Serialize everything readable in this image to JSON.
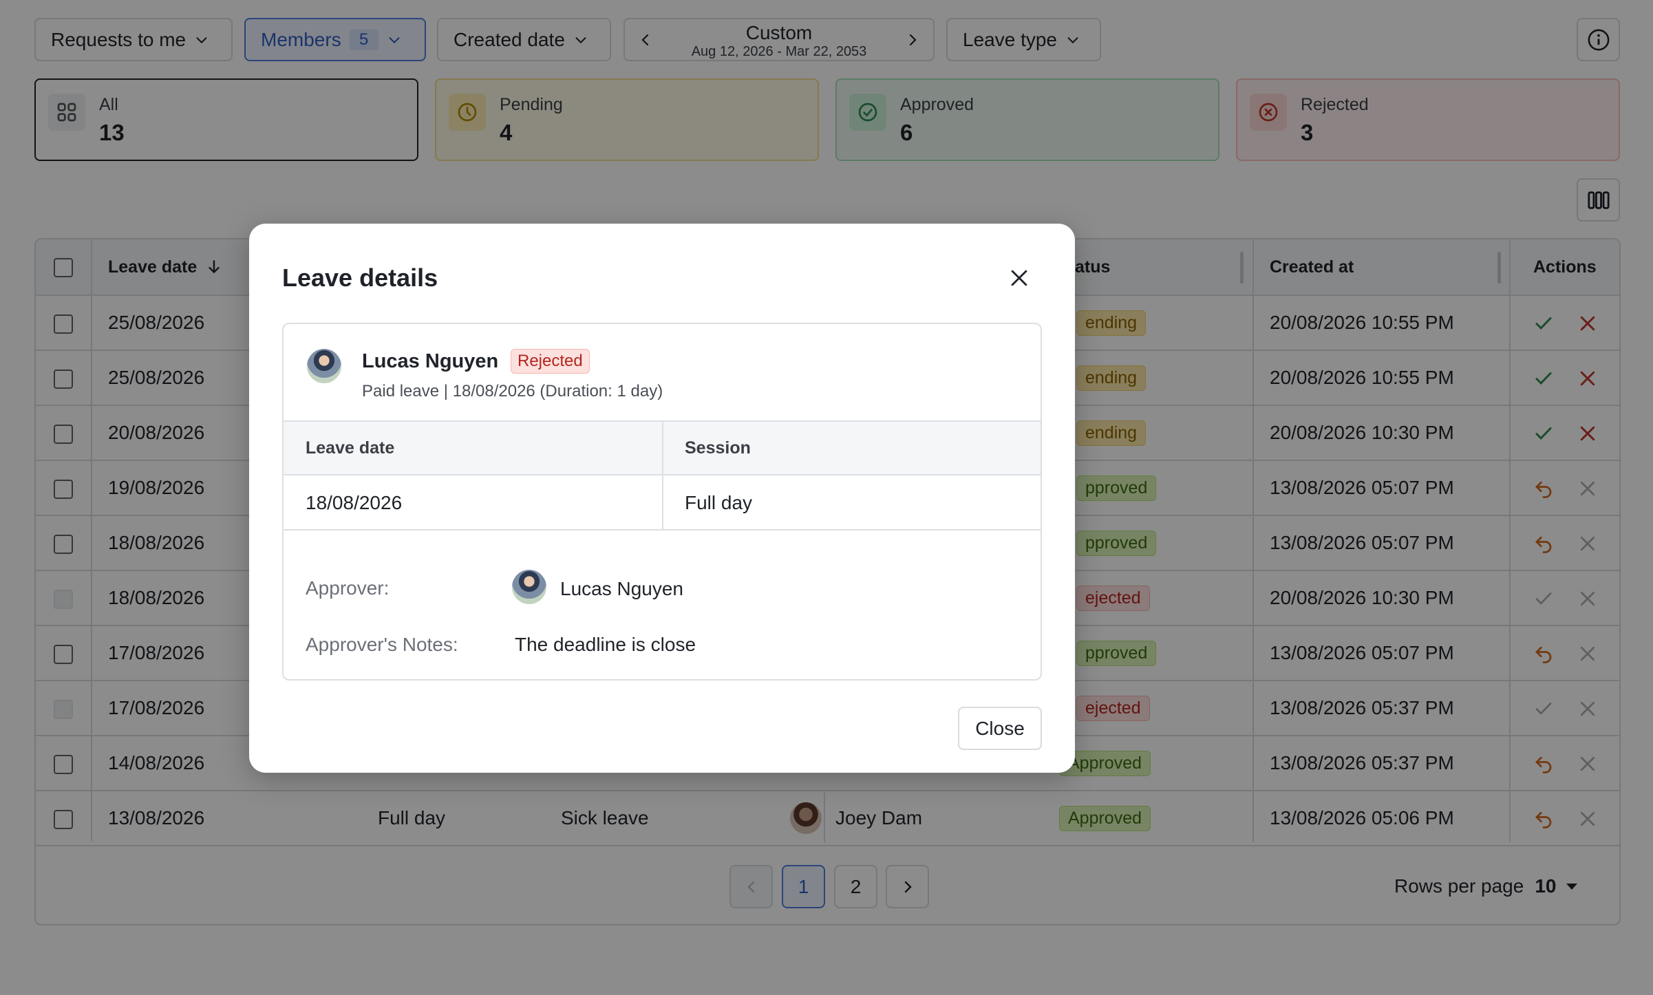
{
  "filters": {
    "requests": "Requests to me",
    "members": "Members",
    "members_count": "5",
    "created_date": "Created date",
    "custom_title": "Custom",
    "custom_range": "Aug 12, 2026 - Mar 22, 2053",
    "leave_type": "Leave type"
  },
  "stats": {
    "all": {
      "label": "All",
      "value": "13"
    },
    "pending": {
      "label": "Pending",
      "value": "4"
    },
    "approved": {
      "label": "Approved",
      "value": "6"
    },
    "rejected": {
      "label": "Rejected",
      "value": "3"
    }
  },
  "table": {
    "headers": {
      "leave_date": "Leave date",
      "status": "atus",
      "created_at": "Created at",
      "actions": "Actions"
    },
    "rows": [
      {
        "date": "25/08/2026",
        "status": "ending",
        "status_type": "pending",
        "created": "20/08/2026 10:55 PM"
      },
      {
        "date": "25/08/2026",
        "status": "ending",
        "status_type": "pending",
        "created": "20/08/2026 10:55 PM"
      },
      {
        "date": "20/08/2026",
        "status": "ending",
        "status_type": "pending",
        "created": "20/08/2026 10:30 PM"
      },
      {
        "date": "19/08/2026",
        "status": "pproved",
        "status_type": "approved",
        "created": "13/08/2026 05:07 PM"
      },
      {
        "date": "18/08/2026",
        "status": "pproved",
        "status_type": "approved",
        "created": "13/08/2026 05:07 PM"
      },
      {
        "date": "18/08/2026",
        "status": "ejected",
        "status_type": "rejected",
        "created": "20/08/2026 10:30 PM"
      },
      {
        "date": "17/08/2026",
        "status": "pproved",
        "status_type": "approved",
        "created": "13/08/2026 05:07 PM"
      },
      {
        "date": "17/08/2026",
        "status": "ejected",
        "status_type": "rejected",
        "created": "13/08/2026 05:37 PM"
      },
      {
        "date": "14/08/2026",
        "status": "Approved",
        "status_type": "approved",
        "created": "13/08/2026 05:37 PM"
      },
      {
        "date": "13/08/2026",
        "session": "Full day",
        "type": "Sick leave",
        "member": "Joey Dam",
        "status": "Approved",
        "status_type": "approved",
        "created": "13/08/2026 05:06 PM"
      }
    ]
  },
  "pagination": {
    "page1": "1",
    "page2": "2",
    "rows_label": "Rows per page",
    "rows_value": "10"
  },
  "modal": {
    "title": "Leave details",
    "name": "Lucas Nguyen",
    "status": "Rejected",
    "subtitle": "Paid leave | 18/08/2026 (Duration: 1 day)",
    "col_leave_date": "Leave date",
    "col_session": "Session",
    "leave_date": "18/08/2026",
    "session": "Full day",
    "approver_label": "Approver:",
    "approver_name": "Lucas Nguyen",
    "notes_label": "Approver's Notes:",
    "notes": "The deadline is close",
    "close_label": "Close"
  },
  "colors": {
    "accent": "#2f5fc4",
    "pending": "#8a6200",
    "approved": "#3f6b12",
    "rejected": "#b3261e"
  }
}
